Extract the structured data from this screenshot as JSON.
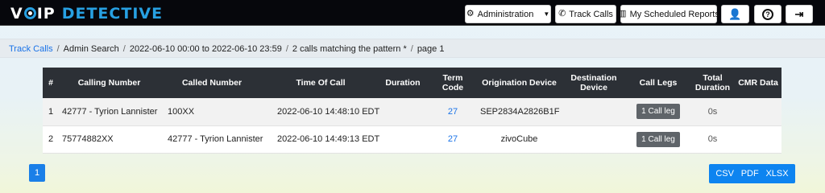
{
  "app": {
    "logo_part1": "V",
    "logo_part1b": "IP",
    "logo_part2": "DETECTIVE"
  },
  "nav": {
    "administration": "Administration",
    "track_calls": "Track Calls",
    "scheduled_reports": "My Scheduled Reports",
    "icons": {
      "administration": "gears-icon",
      "track_calls": "phone-icon",
      "scheduled_reports": "chart-icon",
      "user_settings": "user-gear-icon",
      "help": "help-icon",
      "logout": "logout-icon"
    }
  },
  "breadcrumb": {
    "items": [
      "Track Calls",
      "Admin Search",
      "2022-06-10 00:00 to 2022-06-10 23:59",
      "2 calls matching the pattern *",
      "page 1"
    ]
  },
  "table": {
    "headers": [
      "#",
      "Calling Number",
      "Called Number",
      "Time Of Call",
      "Duration",
      "Term Code",
      "Origination Device",
      "Destination Device",
      "Call Legs",
      "Total Duration",
      "CMR Data"
    ],
    "rows": [
      {
        "num": "1",
        "calling": "42777 - Tyrion Lannister",
        "called": "100XX",
        "time": "2022-06-10 14:48:10 EDT",
        "duration": "",
        "term_code": "27",
        "orig_device": "SEP2834A2826B1F",
        "dest_device": "",
        "call_legs": "1 Call leg",
        "total_duration": "0s",
        "cmr": ""
      },
      {
        "num": "2",
        "calling": "75774882XX",
        "called": "42777 - Tyrion Lannister",
        "time": "2022-06-10 14:49:13 EDT",
        "duration": "",
        "term_code": "27",
        "orig_device": "zivoCube",
        "dest_device": "",
        "call_legs": "1 Call leg",
        "total_duration": "0s",
        "cmr": ""
      }
    ]
  },
  "pagination": {
    "current": "1"
  },
  "export": {
    "csv": "CSV",
    "pdf": "PDF",
    "xlsx": "XLSX"
  },
  "colors": {
    "topbar": "#06070c",
    "accent": "#27a0e2",
    "primary": "#1a7fe8",
    "table_header": "#2c3036"
  }
}
